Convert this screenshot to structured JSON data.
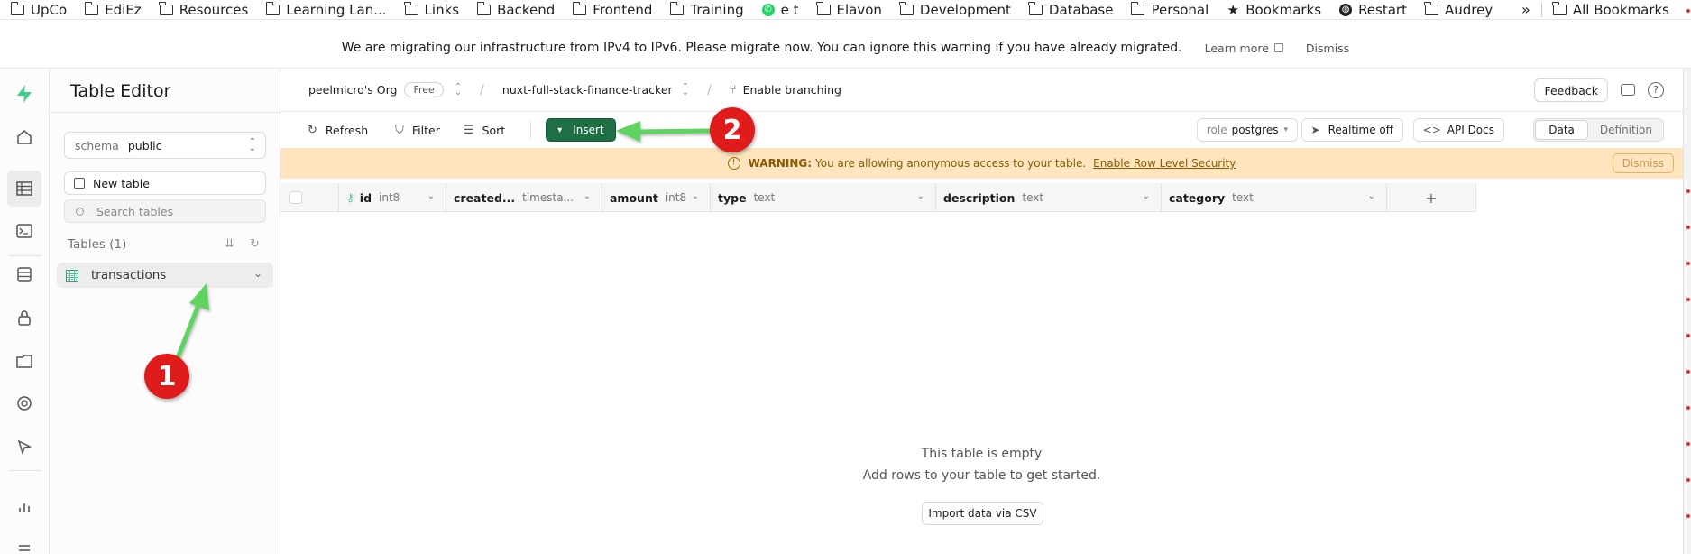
{
  "bookmarks": [
    {
      "label": "UpCo",
      "icon": "folder-icon"
    },
    {
      "label": "EdiEz",
      "icon": "folder-icon"
    },
    {
      "label": "Resources",
      "icon": "folder-icon"
    },
    {
      "label": "Learning Lan...",
      "icon": "folder-icon"
    },
    {
      "label": "Links",
      "icon": "folder-icon"
    },
    {
      "label": "Backend",
      "icon": "folder-icon"
    },
    {
      "label": "Frontend",
      "icon": "folder-icon"
    },
    {
      "label": "Training",
      "icon": "folder-icon"
    },
    {
      "label": "e t",
      "icon": "whatsapp-icon"
    },
    {
      "label": "Elavon",
      "icon": "folder-icon"
    },
    {
      "label": "Development",
      "icon": "folder-icon"
    },
    {
      "label": "Database",
      "icon": "folder-icon"
    },
    {
      "label": "Personal",
      "icon": "folder-icon"
    },
    {
      "label": "Bookmarks",
      "icon": "star-icon"
    },
    {
      "label": "Restart",
      "icon": "globe-icon"
    },
    {
      "label": "Audrey",
      "icon": "folder-icon"
    }
  ],
  "bookmarks_more": "»",
  "all_bookmarks": "All Bookmarks",
  "banner": {
    "message": "We are migrating our infrastructure from IPv4 to IPv6. Please migrate now. You can ignore this warning if you have already migrated.",
    "learn_more": "Learn more",
    "dismiss": "Dismiss"
  },
  "sidebar": {
    "title": "Table Editor",
    "schema_label": "schema",
    "schema_value": "public",
    "new_table": "New table",
    "search_placeholder": "Search tables",
    "tables_header": "Tables (1)",
    "tables": [
      {
        "name": "transactions"
      }
    ]
  },
  "topbar": {
    "org": "peelmicro's Org",
    "plan": "Free",
    "project": "nuxt-full-stack-finance-tracker",
    "branching": "Enable branching",
    "feedback": "Feedback",
    "help": "?"
  },
  "toolbar": {
    "refresh": "Refresh",
    "filter": "Filter",
    "sort": "Sort",
    "insert": "Insert",
    "role_label": "role",
    "role_value": "postgres",
    "realtime": "Realtime off",
    "api_docs": "API Docs",
    "view_data": "Data",
    "view_definition": "Definition"
  },
  "warning": {
    "icon": "!",
    "label": "WARNING:",
    "message": "You are allowing anonymous access to your table.",
    "link": "Enable Row Level Security",
    "dismiss": "Dismiss"
  },
  "columns": [
    {
      "name": "id",
      "type": "int8",
      "primary_key": true
    },
    {
      "name": "created...",
      "type": "timesta..."
    },
    {
      "name": "amount",
      "type": "int8"
    },
    {
      "name": "type",
      "type": "text"
    },
    {
      "name": "description",
      "type": "text"
    },
    {
      "name": "category",
      "type": "text"
    }
  ],
  "add_column": "+",
  "empty_state": {
    "title": "This table is empty",
    "subtitle": "Add rows to your table to get started.",
    "import_button": "Import data via CSV"
  },
  "annotations": [
    {
      "number": "1"
    },
    {
      "number": "2"
    }
  ],
  "colors": {
    "brand": "#3ecf8e",
    "insert_button": "#1f6f45",
    "warning_bg": "#fee5bf",
    "annotation_red": "#e01b1b",
    "arrow_green": "#5fd35f"
  }
}
